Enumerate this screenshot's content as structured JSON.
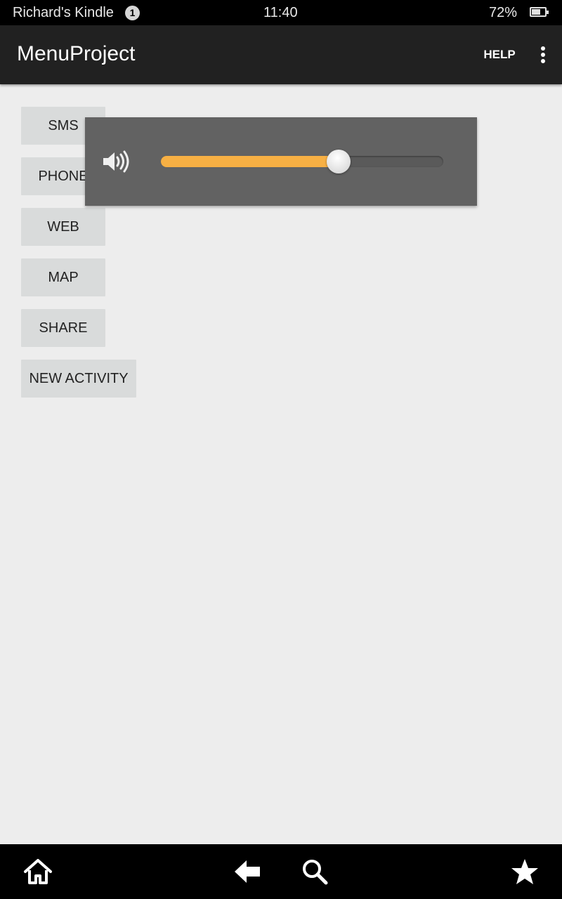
{
  "status_bar": {
    "device_name": "Richard's Kindle",
    "notification_count": "1",
    "time": "11:40",
    "battery_percent": "72%",
    "battery_level": 0.72,
    "icons": [
      "notification-count-icon",
      "battery-icon"
    ]
  },
  "action_bar": {
    "title": "MenuProject",
    "help_label": "HELP",
    "overflow_icon": "overflow-menu-icon"
  },
  "buttons": [
    {
      "label": "SMS"
    },
    {
      "label": "PHONE"
    },
    {
      "label": "WEB"
    },
    {
      "label": "MAP"
    },
    {
      "label": "SHARE"
    },
    {
      "label": "NEW ACTIVITY"
    }
  ],
  "volume_overlay": {
    "icon": "speaker-volume-icon",
    "level": 0.63,
    "accent_color": "#f7b044"
  },
  "nav_bar": {
    "icons": [
      "home-icon",
      "back-icon",
      "search-icon",
      "favorites-star-icon"
    ]
  }
}
